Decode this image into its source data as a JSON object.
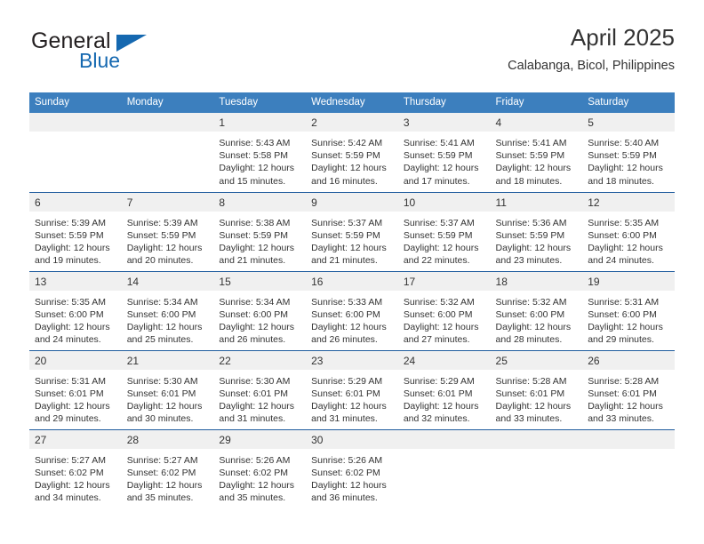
{
  "brand": {
    "name_part1": "General",
    "name_part2": "Blue",
    "triangle_color": "#1568b0"
  },
  "header": {
    "month_title": "April 2025",
    "location": "Calabanga, Bicol, Philippines"
  },
  "colors": {
    "header_row": "#3c7fbe",
    "week_separator": "#1f5c9e",
    "daynum_band": "#f0f0f0",
    "text": "#333333"
  },
  "weekday_headers": [
    "Sunday",
    "Monday",
    "Tuesday",
    "Wednesday",
    "Thursday",
    "Friday",
    "Saturday"
  ],
  "weeks": [
    [
      {
        "day": "",
        "sunrise": "",
        "sunset": "",
        "daylight": "",
        "empty": true
      },
      {
        "day": "",
        "sunrise": "",
        "sunset": "",
        "daylight": "",
        "empty": true
      },
      {
        "day": "1",
        "sunrise": "Sunrise: 5:43 AM",
        "sunset": "Sunset: 5:58 PM",
        "daylight": "Daylight: 12 hours and 15 minutes."
      },
      {
        "day": "2",
        "sunrise": "Sunrise: 5:42 AM",
        "sunset": "Sunset: 5:59 PM",
        "daylight": "Daylight: 12 hours and 16 minutes."
      },
      {
        "day": "3",
        "sunrise": "Sunrise: 5:41 AM",
        "sunset": "Sunset: 5:59 PM",
        "daylight": "Daylight: 12 hours and 17 minutes."
      },
      {
        "day": "4",
        "sunrise": "Sunrise: 5:41 AM",
        "sunset": "Sunset: 5:59 PM",
        "daylight": "Daylight: 12 hours and 18 minutes."
      },
      {
        "day": "5",
        "sunrise": "Sunrise: 5:40 AM",
        "sunset": "Sunset: 5:59 PM",
        "daylight": "Daylight: 12 hours and 18 minutes."
      }
    ],
    [
      {
        "day": "6",
        "sunrise": "Sunrise: 5:39 AM",
        "sunset": "Sunset: 5:59 PM",
        "daylight": "Daylight: 12 hours and 19 minutes."
      },
      {
        "day": "7",
        "sunrise": "Sunrise: 5:39 AM",
        "sunset": "Sunset: 5:59 PM",
        "daylight": "Daylight: 12 hours and 20 minutes."
      },
      {
        "day": "8",
        "sunrise": "Sunrise: 5:38 AM",
        "sunset": "Sunset: 5:59 PM",
        "daylight": "Daylight: 12 hours and 21 minutes."
      },
      {
        "day": "9",
        "sunrise": "Sunrise: 5:37 AM",
        "sunset": "Sunset: 5:59 PM",
        "daylight": "Daylight: 12 hours and 21 minutes."
      },
      {
        "day": "10",
        "sunrise": "Sunrise: 5:37 AM",
        "sunset": "Sunset: 5:59 PM",
        "daylight": "Daylight: 12 hours and 22 minutes."
      },
      {
        "day": "11",
        "sunrise": "Sunrise: 5:36 AM",
        "sunset": "Sunset: 5:59 PM",
        "daylight": "Daylight: 12 hours and 23 minutes."
      },
      {
        "day": "12",
        "sunrise": "Sunrise: 5:35 AM",
        "sunset": "Sunset: 6:00 PM",
        "daylight": "Daylight: 12 hours and 24 minutes."
      }
    ],
    [
      {
        "day": "13",
        "sunrise": "Sunrise: 5:35 AM",
        "sunset": "Sunset: 6:00 PM",
        "daylight": "Daylight: 12 hours and 24 minutes."
      },
      {
        "day": "14",
        "sunrise": "Sunrise: 5:34 AM",
        "sunset": "Sunset: 6:00 PM",
        "daylight": "Daylight: 12 hours and 25 minutes."
      },
      {
        "day": "15",
        "sunrise": "Sunrise: 5:34 AM",
        "sunset": "Sunset: 6:00 PM",
        "daylight": "Daylight: 12 hours and 26 minutes."
      },
      {
        "day": "16",
        "sunrise": "Sunrise: 5:33 AM",
        "sunset": "Sunset: 6:00 PM",
        "daylight": "Daylight: 12 hours and 26 minutes."
      },
      {
        "day": "17",
        "sunrise": "Sunrise: 5:32 AM",
        "sunset": "Sunset: 6:00 PM",
        "daylight": "Daylight: 12 hours and 27 minutes."
      },
      {
        "day": "18",
        "sunrise": "Sunrise: 5:32 AM",
        "sunset": "Sunset: 6:00 PM",
        "daylight": "Daylight: 12 hours and 28 minutes."
      },
      {
        "day": "19",
        "sunrise": "Sunrise: 5:31 AM",
        "sunset": "Sunset: 6:00 PM",
        "daylight": "Daylight: 12 hours and 29 minutes."
      }
    ],
    [
      {
        "day": "20",
        "sunrise": "Sunrise: 5:31 AM",
        "sunset": "Sunset: 6:01 PM",
        "daylight": "Daylight: 12 hours and 29 minutes."
      },
      {
        "day": "21",
        "sunrise": "Sunrise: 5:30 AM",
        "sunset": "Sunset: 6:01 PM",
        "daylight": "Daylight: 12 hours and 30 minutes."
      },
      {
        "day": "22",
        "sunrise": "Sunrise: 5:30 AM",
        "sunset": "Sunset: 6:01 PM",
        "daylight": "Daylight: 12 hours and 31 minutes."
      },
      {
        "day": "23",
        "sunrise": "Sunrise: 5:29 AM",
        "sunset": "Sunset: 6:01 PM",
        "daylight": "Daylight: 12 hours and 31 minutes."
      },
      {
        "day": "24",
        "sunrise": "Sunrise: 5:29 AM",
        "sunset": "Sunset: 6:01 PM",
        "daylight": "Daylight: 12 hours and 32 minutes."
      },
      {
        "day": "25",
        "sunrise": "Sunrise: 5:28 AM",
        "sunset": "Sunset: 6:01 PM",
        "daylight": "Daylight: 12 hours and 33 minutes."
      },
      {
        "day": "26",
        "sunrise": "Sunrise: 5:28 AM",
        "sunset": "Sunset: 6:01 PM",
        "daylight": "Daylight: 12 hours and 33 minutes."
      }
    ],
    [
      {
        "day": "27",
        "sunrise": "Sunrise: 5:27 AM",
        "sunset": "Sunset: 6:02 PM",
        "daylight": "Daylight: 12 hours and 34 minutes."
      },
      {
        "day": "28",
        "sunrise": "Sunrise: 5:27 AM",
        "sunset": "Sunset: 6:02 PM",
        "daylight": "Daylight: 12 hours and 35 minutes."
      },
      {
        "day": "29",
        "sunrise": "Sunrise: 5:26 AM",
        "sunset": "Sunset: 6:02 PM",
        "daylight": "Daylight: 12 hours and 35 minutes."
      },
      {
        "day": "30",
        "sunrise": "Sunrise: 5:26 AM",
        "sunset": "Sunset: 6:02 PM",
        "daylight": "Daylight: 12 hours and 36 minutes."
      },
      {
        "day": "",
        "sunrise": "",
        "sunset": "",
        "daylight": "",
        "empty": true
      },
      {
        "day": "",
        "sunrise": "",
        "sunset": "",
        "daylight": "",
        "empty": true
      },
      {
        "day": "",
        "sunrise": "",
        "sunset": "",
        "daylight": "",
        "empty": true
      }
    ]
  ]
}
